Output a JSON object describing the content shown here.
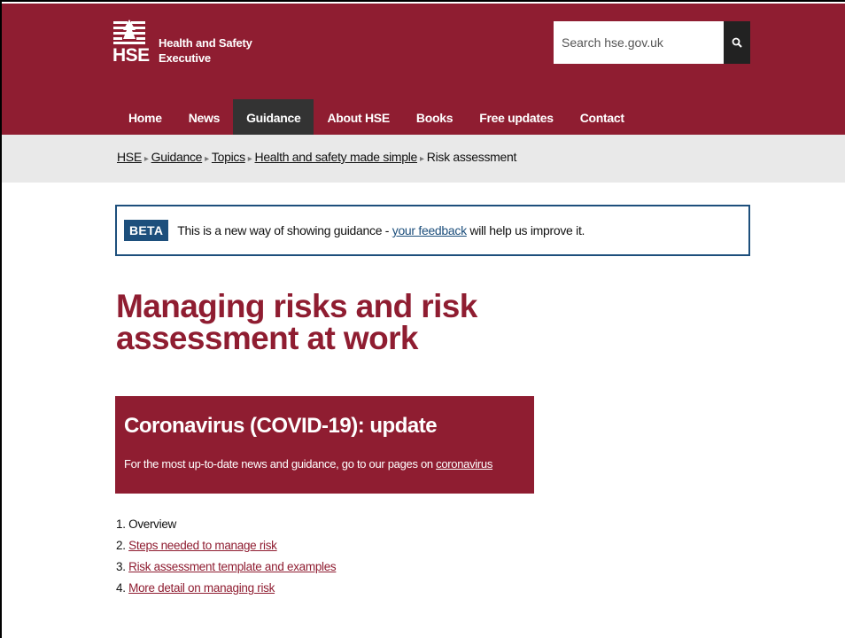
{
  "header": {
    "logo_abbr": "HSE",
    "logo_line1": "Health and Safety",
    "logo_line2": "Executive",
    "search_placeholder": "Search hse.gov.uk",
    "search_icon": "search-icon",
    "brand_color": "#8f1d31"
  },
  "nav": {
    "items": [
      {
        "label": "Home"
      },
      {
        "label": "News"
      },
      {
        "label": "Guidance",
        "active": true
      },
      {
        "label": "About HSE"
      },
      {
        "label": "Books"
      },
      {
        "label": "Free updates"
      },
      {
        "label": "Contact"
      }
    ]
  },
  "breadcrumb": {
    "items": [
      "HSE",
      "Guidance",
      "Topics",
      "Health and safety made simple"
    ],
    "current": "Risk assessment",
    "separator": "▸"
  },
  "beta": {
    "tag": "BETA",
    "text_before": "This is a new way of showing guidance - ",
    "link_text": "your feedback",
    "text_after": " will help us improve it."
  },
  "page": {
    "title_line1": "Managing risks and risk",
    "title_line2": "assessment at work"
  },
  "covid": {
    "title": "Coronavirus (COVID-19): update",
    "text_before": "For the most up-to-date news and guidance, go to our pages on ",
    "link_text": "coronavirus"
  },
  "contents": [
    {
      "number": "1.",
      "label": "Overview",
      "link": false
    },
    {
      "number": "2.",
      "label": "Steps needed to manage risk",
      "link": true
    },
    {
      "number": "3.",
      "label": "Risk assessment template and examples",
      "link": true
    },
    {
      "number": "4.",
      "label": "More detail on managing risk",
      "link": true
    }
  ]
}
